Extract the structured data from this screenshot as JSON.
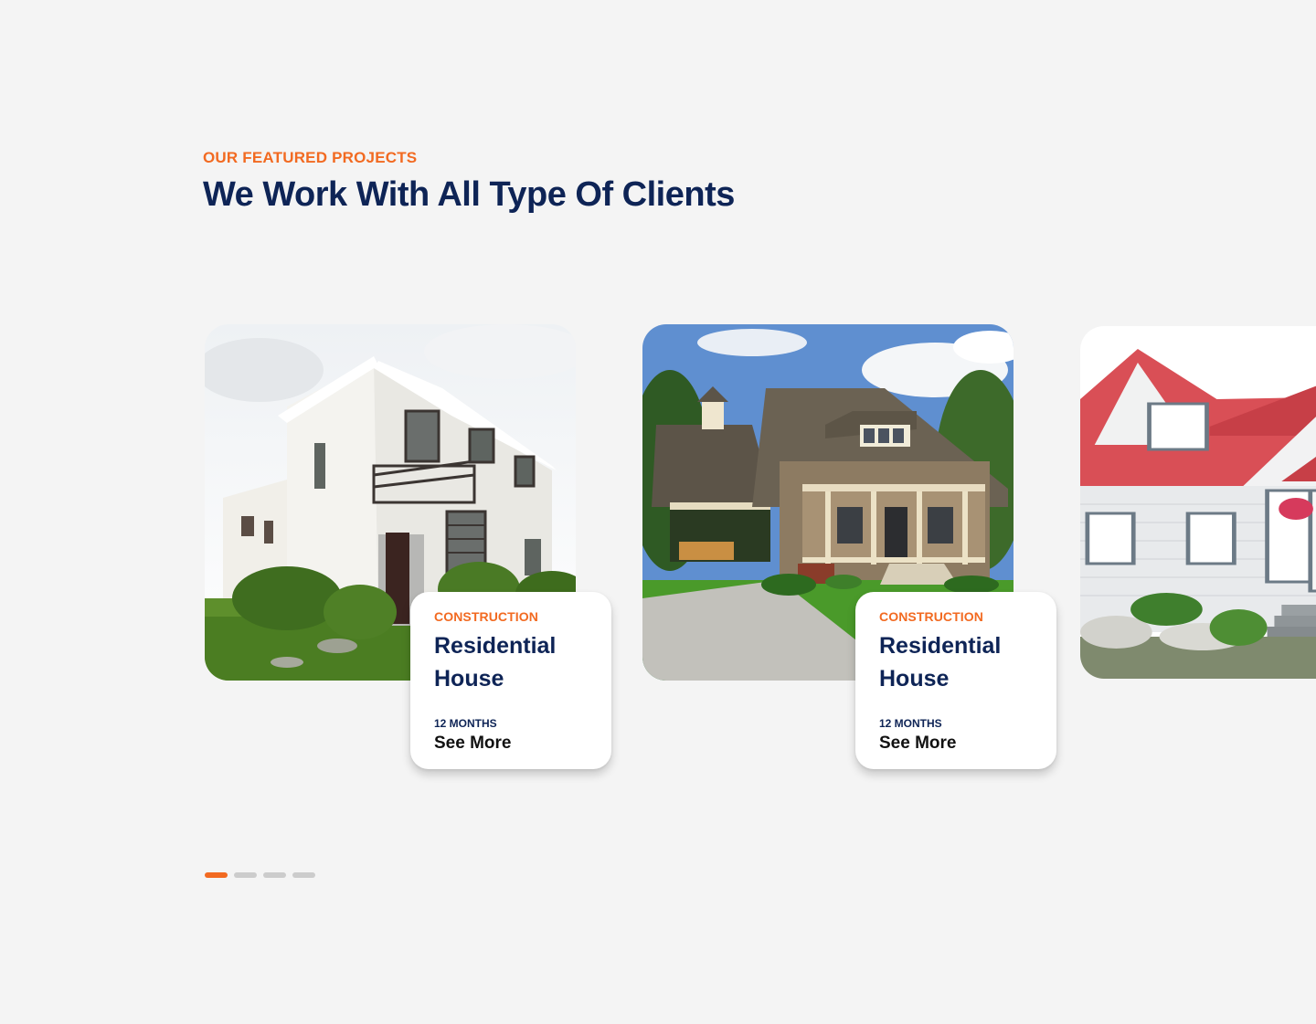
{
  "section": {
    "eyebrow": "OUR FEATURED PROJECTS",
    "headline": "We Work With All Type Of Clients"
  },
  "projects": [
    {
      "category": "CONSTRUCTION",
      "title": "Residential House",
      "duration": "12 MONTHS",
      "link": "See More",
      "image": "modern-white-two-storey-house"
    },
    {
      "category": "CONSTRUCTION",
      "title": "Residential House",
      "duration": "12 MONTHS",
      "link": "See More",
      "image": "craftsman-bungalow-with-porch"
    },
    {
      "image": "white-cottage-red-roof"
    }
  ],
  "pagination": {
    "count": 4,
    "active_index": 0
  },
  "colors": {
    "accent": "#f26a21",
    "navy": "#0e2456",
    "background": "#f4f4f4",
    "dot_inactive": "#cccccc"
  }
}
